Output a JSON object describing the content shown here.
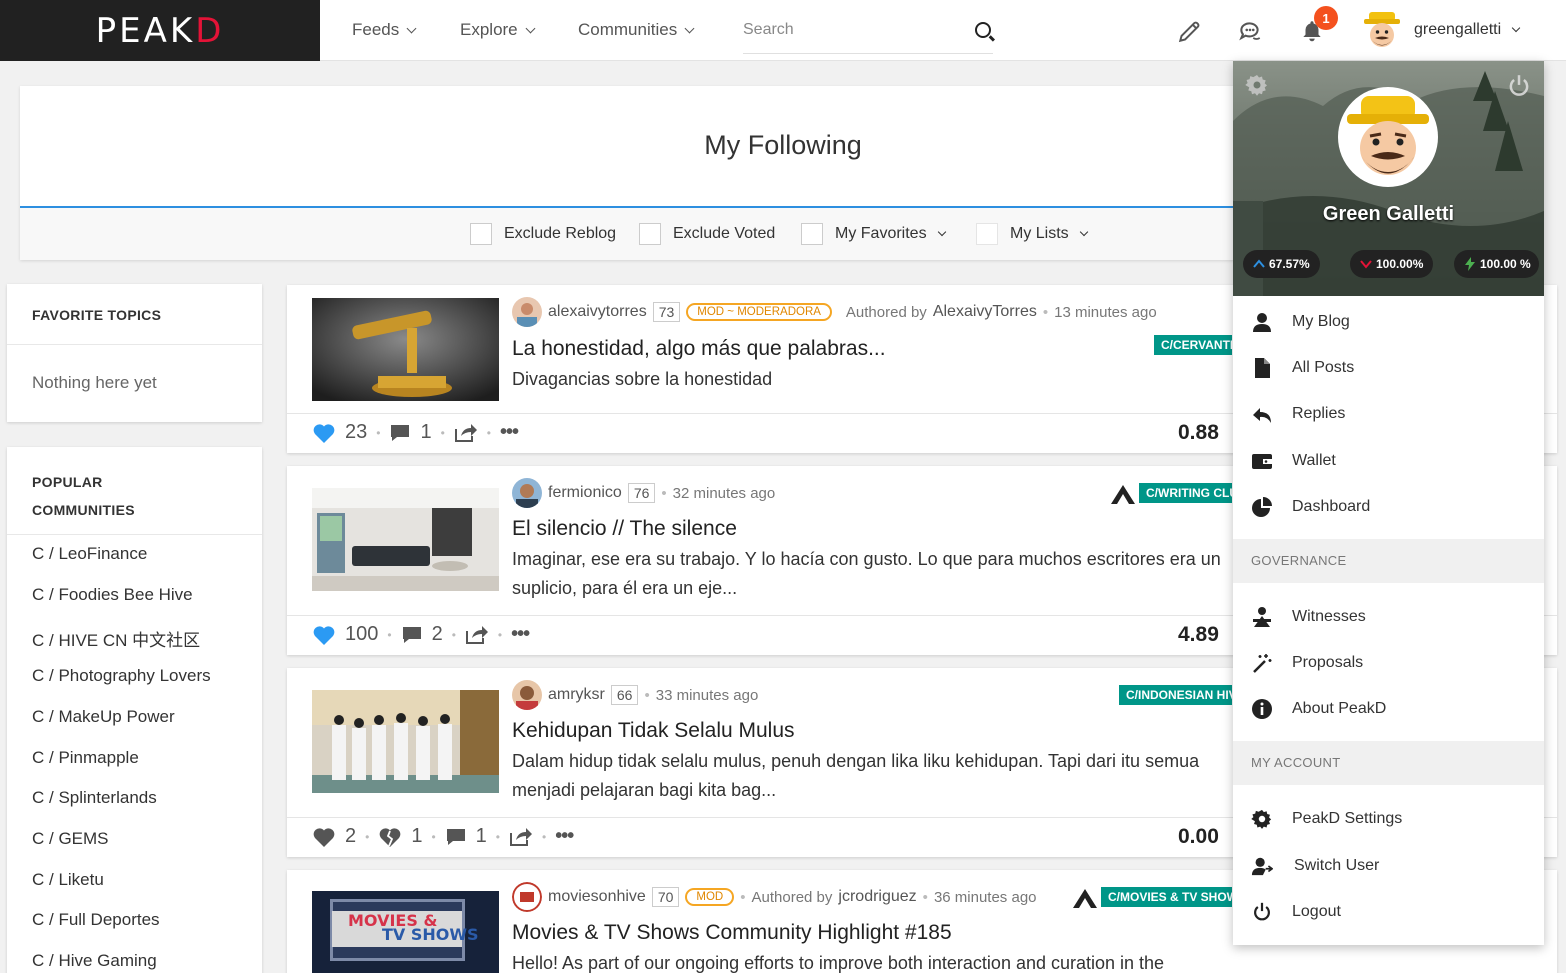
{
  "nav": {
    "logo": "PEAKD",
    "feeds": "Feeds",
    "explore": "Explore",
    "communities": "Communities",
    "search_placeholder": "Search",
    "notification_count": "1",
    "username": "greengalletti"
  },
  "header": {
    "title": "My Following",
    "filters": {
      "exclude_reblog": "Exclude Reblog",
      "exclude_voted": "Exclude Voted",
      "my_favorites": "My Favorites",
      "my_lists": "My Lists"
    }
  },
  "sidebar": {
    "favorite_topics_title": "FAVORITE TOPICS",
    "favorite_topics_empty": "Nothing here yet",
    "popular_title_line1": "POPULAR",
    "popular_title_line2": "COMMUNITIES",
    "communities": [
      "C / LeoFinance",
      "C / Foodies Bee Hive",
      "C / HIVE CN 中文社区",
      "C / Photography Lovers",
      "C / MakeUp Power",
      "C / Pinmapple",
      "C / Splinterlands",
      "C / GEMS",
      "C / Liketu",
      "C / Full Deportes",
      "C / Hive Gaming"
    ]
  },
  "posts": [
    {
      "author": "alexaivytorres",
      "reputation": "73",
      "role": "MOD ~ MODERADORA",
      "authored_by_label": "Authored by",
      "authored_by": "AlexaivyTorres",
      "time": "13 minutes ago",
      "community": "C/CERVANTES",
      "title": "La honestidad, algo más que palabras...",
      "summary": "Divagancias sobre la honestidad",
      "votes": "23",
      "comments": "1",
      "payout": "0.88"
    },
    {
      "author": "fermionico",
      "reputation": "76",
      "time": "32 minutes ago",
      "community": "C/WRITING CLUB",
      "title": "El silencio // The silence",
      "summary": "Imaginar, ese era su trabajo. Y lo hacía con gusto. Lo que para muchos escritores era un suplicio, para él era un eje...",
      "votes": "100",
      "comments": "2",
      "payout": "4.89"
    },
    {
      "author": "amryksr",
      "reputation": "66",
      "time": "33 minutes ago",
      "community": "C/INDONESIAN HIVE",
      "title": "Kehidupan Tidak Selalu Mulus",
      "summary": "Dalam hidup tidak selalu mulus, penuh dengan lika liku kehidupan. Tapi dari itu semua menjadi pelajaran bagi kita bag...",
      "votes": "2",
      "downvotes": "1",
      "comments": "1",
      "payout": "0.00"
    },
    {
      "author": "moviesonhive",
      "reputation": "70",
      "role": "MOD",
      "authored_by_label": "Authored by",
      "authored_by": "jcrodriguez",
      "time": "36 minutes ago",
      "community": "C/MOVIES & TV SHOWS",
      "title": "Movies & TV Shows Community Highlight #185",
      "summary": "Hello! As part of our ongoing efforts to improve both interaction and curation in the",
      "thumb_text_1": "MOVIES &",
      "thumb_text_2": "TV SHOWS"
    }
  ],
  "dropdown": {
    "display_name": "Green Galletti",
    "stats": {
      "voting_power": "67.57%",
      "downvote_power": "100.00%",
      "resource_credits": "100.00 %"
    },
    "items": {
      "my_blog": "My Blog",
      "all_posts": "All Posts",
      "replies": "Replies",
      "wallet": "Wallet",
      "dashboard": "Dashboard",
      "witnesses": "Witnesses",
      "proposals": "Proposals",
      "about": "About PeakD",
      "settings": "PeakD Settings",
      "switch_user": "Switch User",
      "logout": "Logout"
    },
    "section_governance": "GOVERNANCE",
    "section_account": "MY ACCOUNT"
  },
  "colors": {
    "accent": "#2d8fe0",
    "brand_red": "#e31337",
    "community_tag": "#009688",
    "badge": "#f4511e",
    "mod_orange": "#f5a623"
  }
}
